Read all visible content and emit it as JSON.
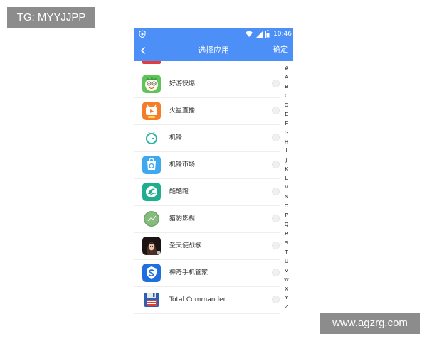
{
  "watermarks": {
    "top": "TG: MYYJJPP",
    "bottom": "www.agzrg.com"
  },
  "status_bar": {
    "time": "10:46"
  },
  "header": {
    "title": "选择应用",
    "confirm_label": "确定"
  },
  "apps": [
    {
      "label": "好游快爆",
      "icon": "haoyou-icon"
    },
    {
      "label": "火星直播",
      "icon": "huoxing-tv-icon"
    },
    {
      "label": "机锋",
      "icon": "jifeng-icon"
    },
    {
      "label": "机锋市场",
      "icon": "jifeng-market-icon"
    },
    {
      "label": "酷酷跑",
      "icon": "kukupao-icon"
    },
    {
      "label": "猎豹影视",
      "icon": "liebao-icon"
    },
    {
      "label": "圣天使战歌",
      "icon": "game-angel-icon"
    },
    {
      "label": "神奇手机管家",
      "icon": "shield-manager-icon"
    },
    {
      "label": "Total Commander",
      "icon": "floppy-disk-icon"
    }
  ],
  "index_letters": [
    "#",
    "A",
    "B",
    "C",
    "D",
    "E",
    "F",
    "G",
    "H",
    "I",
    "J",
    "K",
    "L",
    "M",
    "N",
    "O",
    "P",
    "Q",
    "R",
    "S",
    "T",
    "U",
    "V",
    "W",
    "X",
    "Y",
    "Z"
  ],
  "colors": {
    "accent": "#4b8ff7"
  }
}
